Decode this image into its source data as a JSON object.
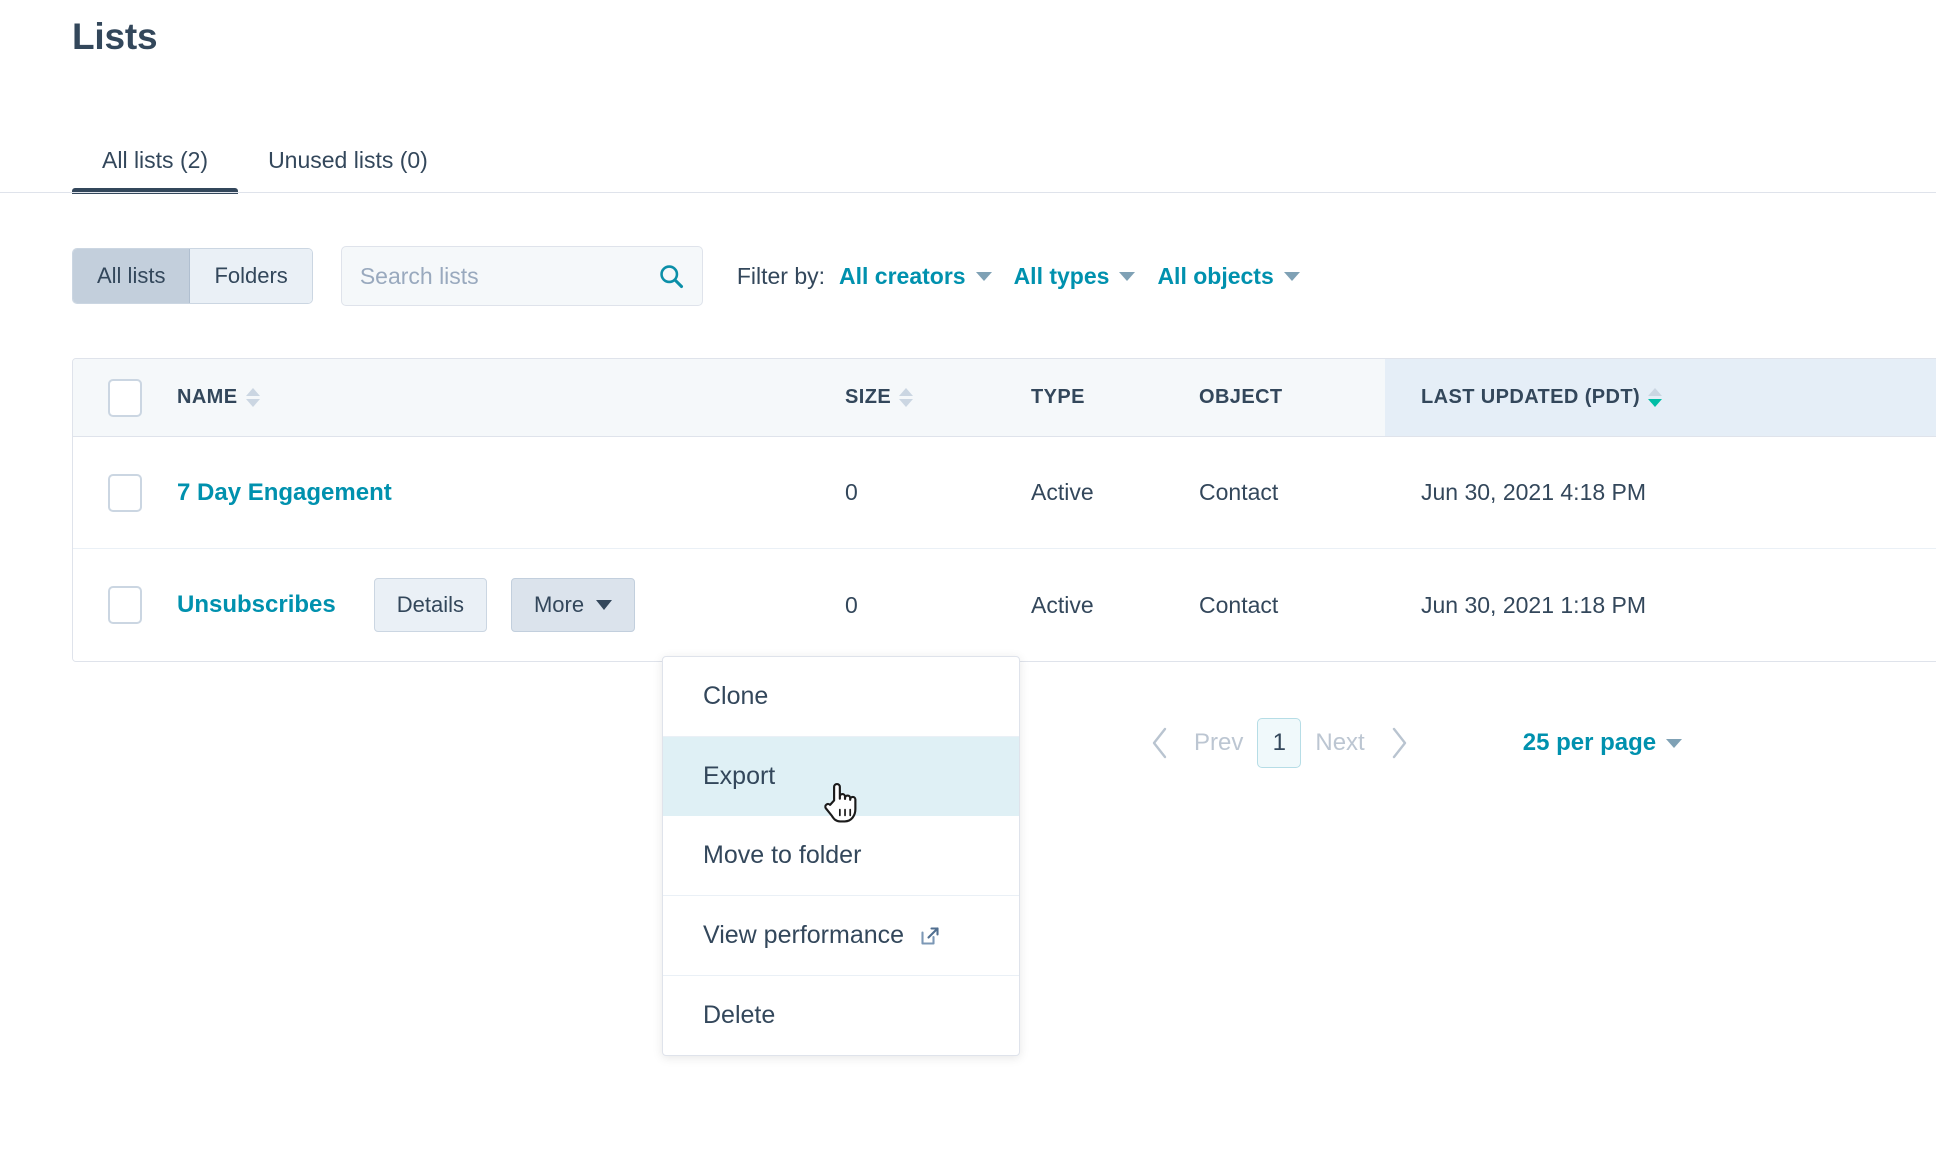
{
  "page": {
    "title": "Lists"
  },
  "tabs": [
    {
      "label": "All lists (2)",
      "name": "tab-all-lists",
      "active": true
    },
    {
      "label": "Unused lists (0)",
      "name": "tab-unused-lists",
      "active": false
    }
  ],
  "toolbar": {
    "segmented": [
      {
        "label": "All lists",
        "selected": true
      },
      {
        "label": "Folders",
        "selected": false
      }
    ],
    "search": {
      "placeholder": "Search lists",
      "value": "",
      "icon": "search-icon"
    },
    "filter_label": "Filter by:",
    "filters": [
      {
        "label": "All creators"
      },
      {
        "label": "All types"
      },
      {
        "label": "All objects"
      }
    ]
  },
  "table": {
    "columns": [
      {
        "key": "name",
        "label": "NAME",
        "sortable": true,
        "sorted": false
      },
      {
        "key": "size",
        "label": "SIZE",
        "sortable": true,
        "sorted": false
      },
      {
        "key": "type",
        "label": "TYPE",
        "sortable": false,
        "sorted": false
      },
      {
        "key": "object",
        "label": "OBJECT",
        "sortable": false,
        "sorted": false
      },
      {
        "key": "updated",
        "label": "LAST UPDATED (PDT)",
        "sortable": true,
        "sorted": true,
        "direction": "desc"
      }
    ],
    "rows": [
      {
        "name": "7 Day Engagement",
        "size": "0",
        "type": "Active",
        "object": "Contact",
        "updated": "Jun 30, 2021 4:18 PM",
        "selected": false,
        "hovered": false
      },
      {
        "name": "Unsubscribes",
        "size": "0",
        "type": "Active",
        "object": "Contact",
        "updated": "Jun 30, 2021 1:18 PM",
        "selected": false,
        "hovered": true,
        "actions": [
          {
            "label": "Details",
            "name": "details-button",
            "pressed": false
          },
          {
            "label": "More",
            "name": "more-button",
            "pressed": true,
            "caret": true
          }
        ]
      }
    ]
  },
  "more_menu": {
    "open": true,
    "groups": [
      {
        "items": [
          {
            "label": "Clone",
            "hover": false
          }
        ]
      },
      {
        "items": [
          {
            "label": "Export",
            "hover": true
          },
          {
            "label": "Move to folder",
            "hover": false
          }
        ]
      },
      {
        "items": [
          {
            "label": "View performance",
            "hover": false,
            "icon": "external-link-icon"
          }
        ]
      },
      {
        "items": [
          {
            "label": "Delete",
            "hover": false
          }
        ]
      }
    ]
  },
  "pagination": {
    "prev_label": "Prev",
    "next_label": "Next",
    "current_page": "1",
    "per_page_label": "25 per page"
  },
  "colors": {
    "link": "#0091ae",
    "text": "#33475b",
    "sort_active": "#00bda5",
    "header_bg": "#f5f8fa",
    "sorted_col_bg": "#e5eef7",
    "menu_hover": "#dff0f5",
    "border": "#dfe3eb"
  }
}
